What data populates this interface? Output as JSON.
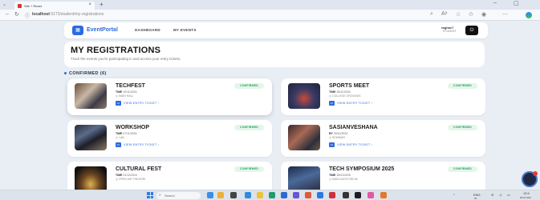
{
  "browser": {
    "tab_title": "Vite + React",
    "url_host": "localhost",
    "url_path": ":5173/student/my-registrations"
  },
  "navbar": {
    "brand": "EventPortal",
    "links": [
      "DASHBOARD",
      "MY EVENTS"
    ],
    "user_name": "raghav7",
    "user_role": "STUDENT"
  },
  "header": {
    "title": "MY REGISTRATIONS",
    "subtitle": "Track the events you're participating in and access your entry tickets."
  },
  "section": {
    "label": "CONFIRMED (6)"
  },
  "registrations": [
    {
      "title": "TECHFEST",
      "date_label": "TIME",
      "date": "10/11/2024",
      "location": "MAIN HALL",
      "ticket": "VIEW ENTRY TICKET",
      "status": "CONFIRMED"
    },
    {
      "title": "SPORTS MEET",
      "date_label": "TIME",
      "date": "15/11/2024",
      "location": "COLLEGE GROUNDS",
      "ticket": "VIEW ENTRY TICKET",
      "status": "CONFIRMED"
    },
    {
      "title": "WORKSHOP",
      "date_label": "TIME",
      "date": "07/11/2024",
      "location": "LAB",
      "ticket": "VIEW ENTRY TICKET",
      "status": "CONFIRMED"
    },
    {
      "title": "SASIANVESHANA",
      "date_label": "BY",
      "date": "20/11/2024",
      "location": "SEMINAR",
      "ticket": "VIEW ENTRY TICKET",
      "status": "CONFIRMED"
    },
    {
      "title": "CULTURAL FEST",
      "date_label": "TIME",
      "date": "01/12/2024",
      "location": "OPEN AIR THEATRE",
      "ticket": "VIEW ENTRY TICKET",
      "status": "CONFIRMED"
    },
    {
      "title": "TECH SYMPOSIUM 2025",
      "date_label": "TIME",
      "date": "15/01/2025",
      "location": "MAIN AUDITORIUM",
      "ticket": "VIEW ENTRY TICKET",
      "status": "CONFIRMED"
    }
  ],
  "taskbar": {
    "search_placeholder": "Search",
    "tray_lang": "ENG",
    "tray_region": "IN",
    "time": "13:4",
    "date": "26-07-202"
  },
  "colors": {
    "accent": "#2b6bdf",
    "confirmed_text": "#22a35a",
    "confirmed_bg": "#e4f6ea",
    "page_bg": "#e9eef5"
  }
}
